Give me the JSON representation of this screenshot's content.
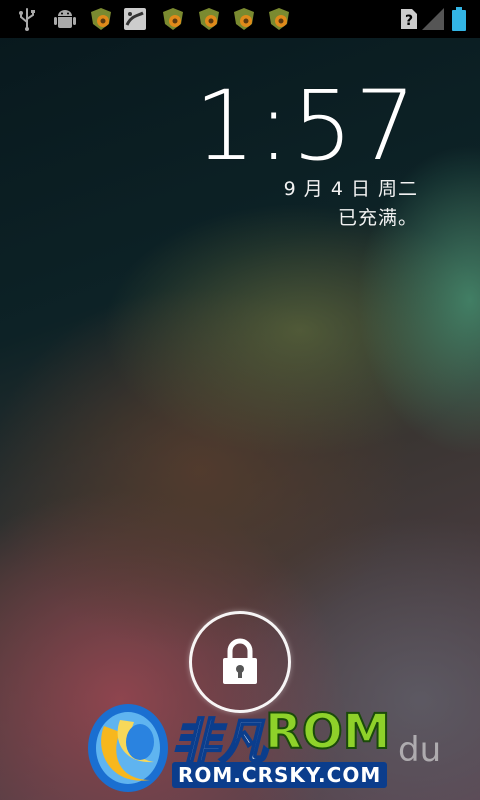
{
  "status_bar": {
    "left_icons": [
      "usb-icon",
      "android-debug-icon",
      "app-notification-icon",
      "image-notification-icon",
      "app-notification-icon",
      "app-notification-icon",
      "app-notification-icon",
      "app-notification-icon"
    ],
    "right_icons": [
      "no-sim-icon",
      "signal-icon",
      "battery-icon"
    ],
    "battery_level": 1.0,
    "battery_color": "#33b5e5"
  },
  "lockscreen": {
    "time": "1:57",
    "date": "9 月 4 日 周二",
    "charge_status": "已充满。",
    "unlock_icon": "lock-icon"
  },
  "watermark": {
    "brand_cn": "非凡",
    "brand_rom": "ROM",
    "url": "ROM.CRSKY.COM",
    "partial_text": "du"
  },
  "colors": {
    "status_bar_bg": "#000000",
    "text": "#ffffff",
    "accent": "#33b5e5"
  }
}
